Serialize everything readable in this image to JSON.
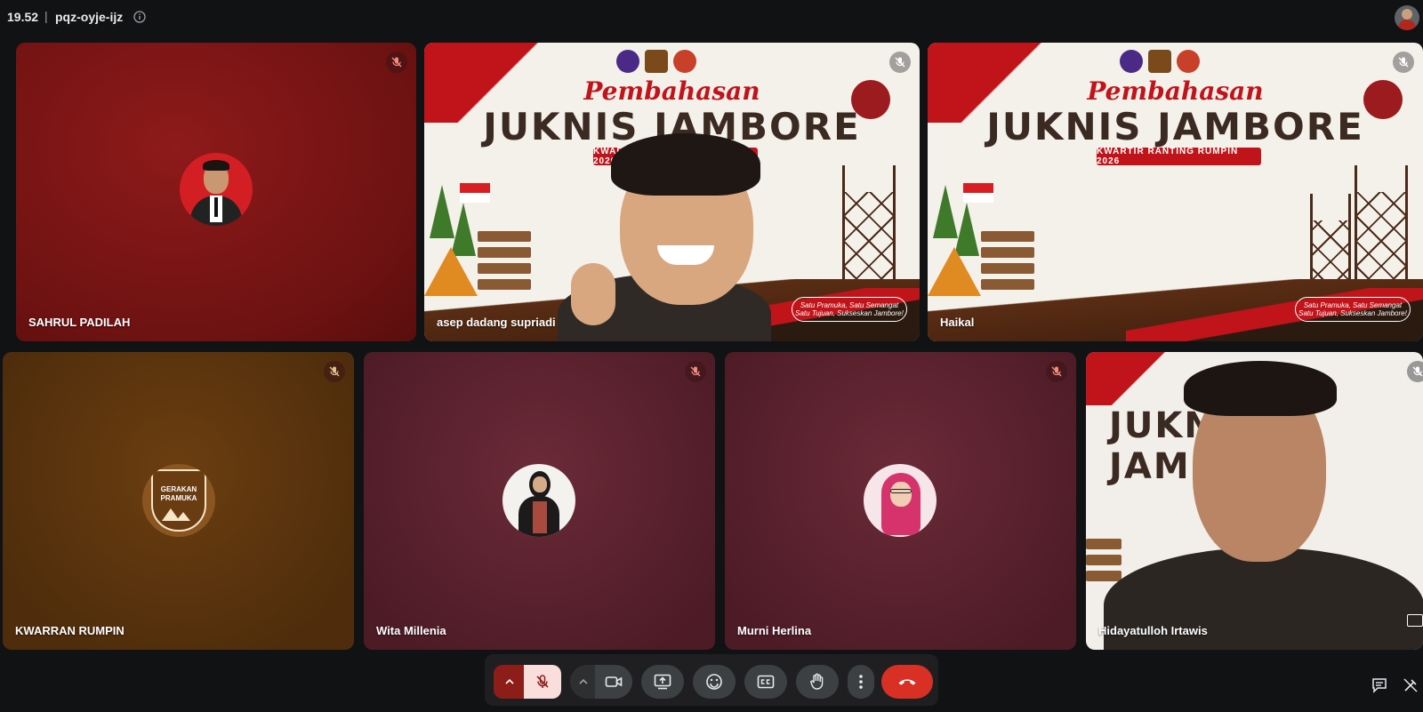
{
  "meeting": {
    "time": "19.52",
    "separator": "|",
    "code": "pqz-oyje-ijz"
  },
  "banner": {
    "script_title": "Pembahasan",
    "main_title": "JUKNIS JAMBORE",
    "strip_text": "KWARTIR RANTING RUMPIN 2026",
    "bottom_text": "Satu Pramuka, Satu Semangat Satu Tujuan, Sukseskan Jambore!",
    "t7_title": "JUKNIS JAMBORE"
  },
  "participants": [
    {
      "name": "SAHRUL PADILAH",
      "muted": true,
      "bg": "#7a1414"
    },
    {
      "name": "asep dadang supriadi",
      "muted": true,
      "bg": "#f4f0ea"
    },
    {
      "name": "Haikal",
      "muted": true,
      "bg": "#f4f0ea"
    },
    {
      "name": "KWARRAN RUMPIN",
      "muted": true,
      "bg": "#5a340e"
    },
    {
      "name": "Wita Millenia",
      "muted": true,
      "bg": "#5a2230"
    },
    {
      "name": "Murni Herlina",
      "muted": true,
      "bg": "#5a2230"
    },
    {
      "name": "Hidayatulloh Irtawis",
      "muted": true,
      "bg": "#f2efea"
    }
  ],
  "logo_text": {
    "line1": "GERAKAN",
    "line2": "PRAMUKA"
  },
  "colors": {
    "end_call": "#d93025",
    "mic_off_bg": "#f9dedc",
    "mic_off_icon": "#8c1d18",
    "toolbar_bg": "#1f1f22",
    "button_bg": "#3c4043"
  },
  "controls": {
    "mic": "mic-off-icon",
    "camera": "video-camera-icon",
    "present": "present-screen-icon",
    "reactions": "emoji-icon",
    "captions": "closed-captions-icon",
    "raise_hand": "raise-hand-icon",
    "more": "more-vertical-icon",
    "leave": "end-call-icon"
  }
}
